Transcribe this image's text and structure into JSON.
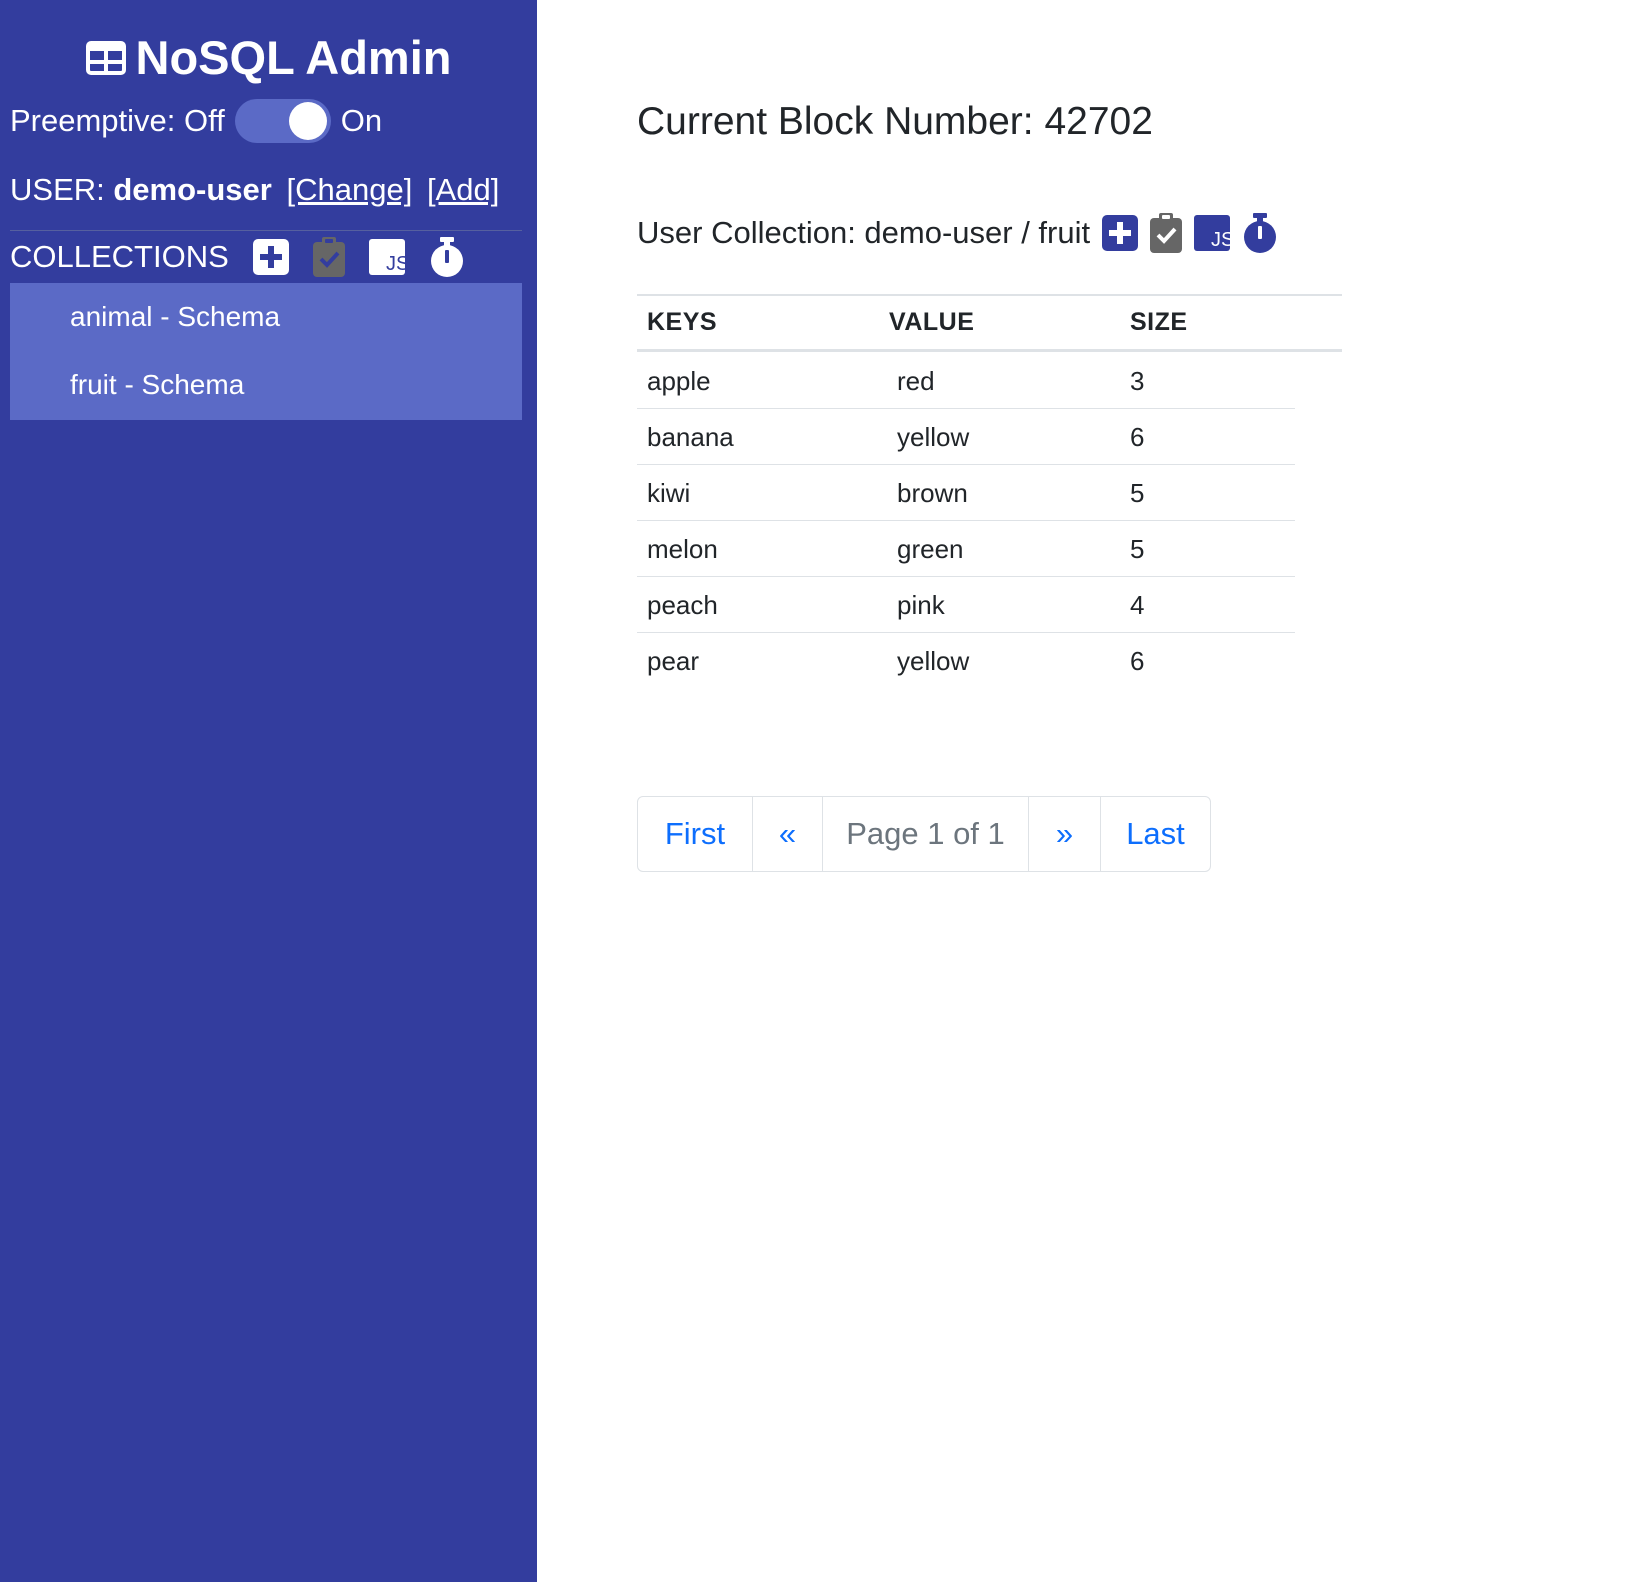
{
  "sidebar": {
    "brand": "NoSQL Admin",
    "brand_icon": "table-icon",
    "preemptive_off_label": "Preemptive: Off",
    "preemptive_on_label": "On",
    "preemptive_state": "on",
    "user_prefix": "USER:",
    "user_name": "demo-user",
    "change_link": "[Change]",
    "add_link": "[Add]",
    "collections_heading": "COLLECTIONS",
    "collections_icons": [
      "plus-square-icon",
      "clipboard-check-icon",
      "js-icon",
      "stopwatch-icon"
    ],
    "collections": [
      {
        "label": "animal - Schema"
      },
      {
        "label": "fruit - Schema"
      }
    ]
  },
  "main": {
    "block_title": "Current Block Number: 42702",
    "collection_title": "User Collection: demo-user / fruit",
    "collection_icons": [
      "plus-square-icon",
      "clipboard-check-icon",
      "js-icon",
      "stopwatch-icon"
    ],
    "table": {
      "headers": [
        "KEYS",
        "VALUE",
        "SIZE"
      ],
      "rows": [
        {
          "key": "apple",
          "value": "red",
          "size": "3"
        },
        {
          "key": "banana",
          "value": "yellow",
          "size": "6"
        },
        {
          "key": "kiwi",
          "value": "brown",
          "size": "5"
        },
        {
          "key": "melon",
          "value": "green",
          "size": "5"
        },
        {
          "key": "peach",
          "value": "pink",
          "size": "4"
        },
        {
          "key": "pear",
          "value": "yellow",
          "size": "6"
        }
      ]
    },
    "pagination": {
      "first": "First",
      "prev": "«",
      "info": "Page 1 of 1",
      "next": "»",
      "last": "Last"
    }
  },
  "colors": {
    "sidebar_bg": "#333d9e",
    "sidebar_highlight": "#5b6ac6",
    "link_blue": "#0d6efd",
    "icon_blue": "#333d9e",
    "icon_gray": "#666666"
  }
}
